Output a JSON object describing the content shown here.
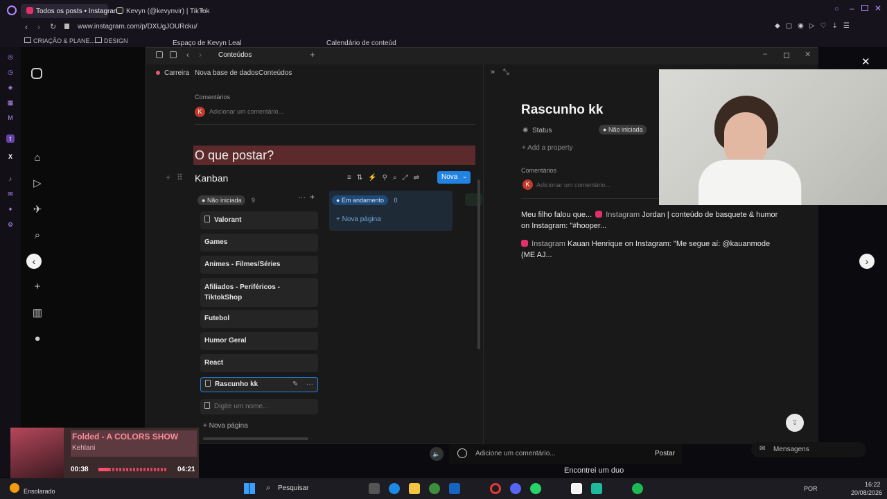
{
  "browser": {
    "tabs": [
      {
        "label": "Todos os posts • Instagram",
        "active": true
      },
      {
        "label": "Kevyn (@kevynvir) | TikTok",
        "active": false
      }
    ],
    "url": "www.instagram.com/p/DXUgJOURcku/",
    "bookmarks": [
      "CRIAÇÃO & PLANE...",
      "DESIGN"
    ]
  },
  "notion": {
    "behind_tabs": [
      "Espaço de Kevyn Leal",
      "Calendário de conteúd"
    ],
    "window_tab": "Conteúdos",
    "breadcrumb": [
      "Carreira",
      "Nova base de dados",
      "Conteúdos"
    ],
    "comments_label": "Comentários",
    "comment_placeholder": "Adicionar um comentário...",
    "avatar_letter": "K",
    "heading": "O que postar?",
    "kanban_title": "Kanban",
    "new_button": "Nova",
    "columns": [
      {
        "status": "Não iniciada",
        "count": "9"
      },
      {
        "status": "Em andamento",
        "count": "0"
      }
    ],
    "new_page_label": "Nova página",
    "cards": [
      "Valorant",
      "Games",
      "Animes - Filmes/Séries",
      "Afiliados - Periféricos - TiktokShop",
      "Futebol",
      "Humor Geral",
      "React",
      "Rascunho kk"
    ],
    "name_placeholder": "Digite um nome...",
    "page": {
      "title": "Rascunho kk",
      "status_label": "Status",
      "status_value": "Não iniciada",
      "add_property": "Add a property",
      "comments_label": "Comentários",
      "comment_placeholder": "Adicionar um comentário...",
      "body_1": "Meu filho falou que...",
      "link_1_prefix": "Instagram",
      "link_1_text": "Jordan | conteúdo de basquete & humor on Instagram: \"#hooper...",
      "link_2_prefix": "Instagram",
      "link_2_text": "Kauan Henrique on Instagram: \"Me segue aí: @kauanmode (ME AJ..."
    }
  },
  "music": {
    "title": "Folded - A COLORS SHOW",
    "artist": "Kehlani",
    "elapsed": "00:38",
    "duration": "04:21",
    "progress": 0.15
  },
  "ig_comment": {
    "placeholder": "Adicione um comentário...",
    "post_label": "Postar"
  },
  "video_caption": "Encontrei um duo",
  "messages_label": "Mensagens",
  "taskbar": {
    "weather": "Ensolarado",
    "search": "Pesquisar",
    "lang": "POR",
    "time": "16:22",
    "date": "20/08/2026"
  },
  "colors": {
    "accent_blue": "#2383e2",
    "heading_red": "#5c2a2a",
    "status_grey": "#3a3a3a"
  }
}
